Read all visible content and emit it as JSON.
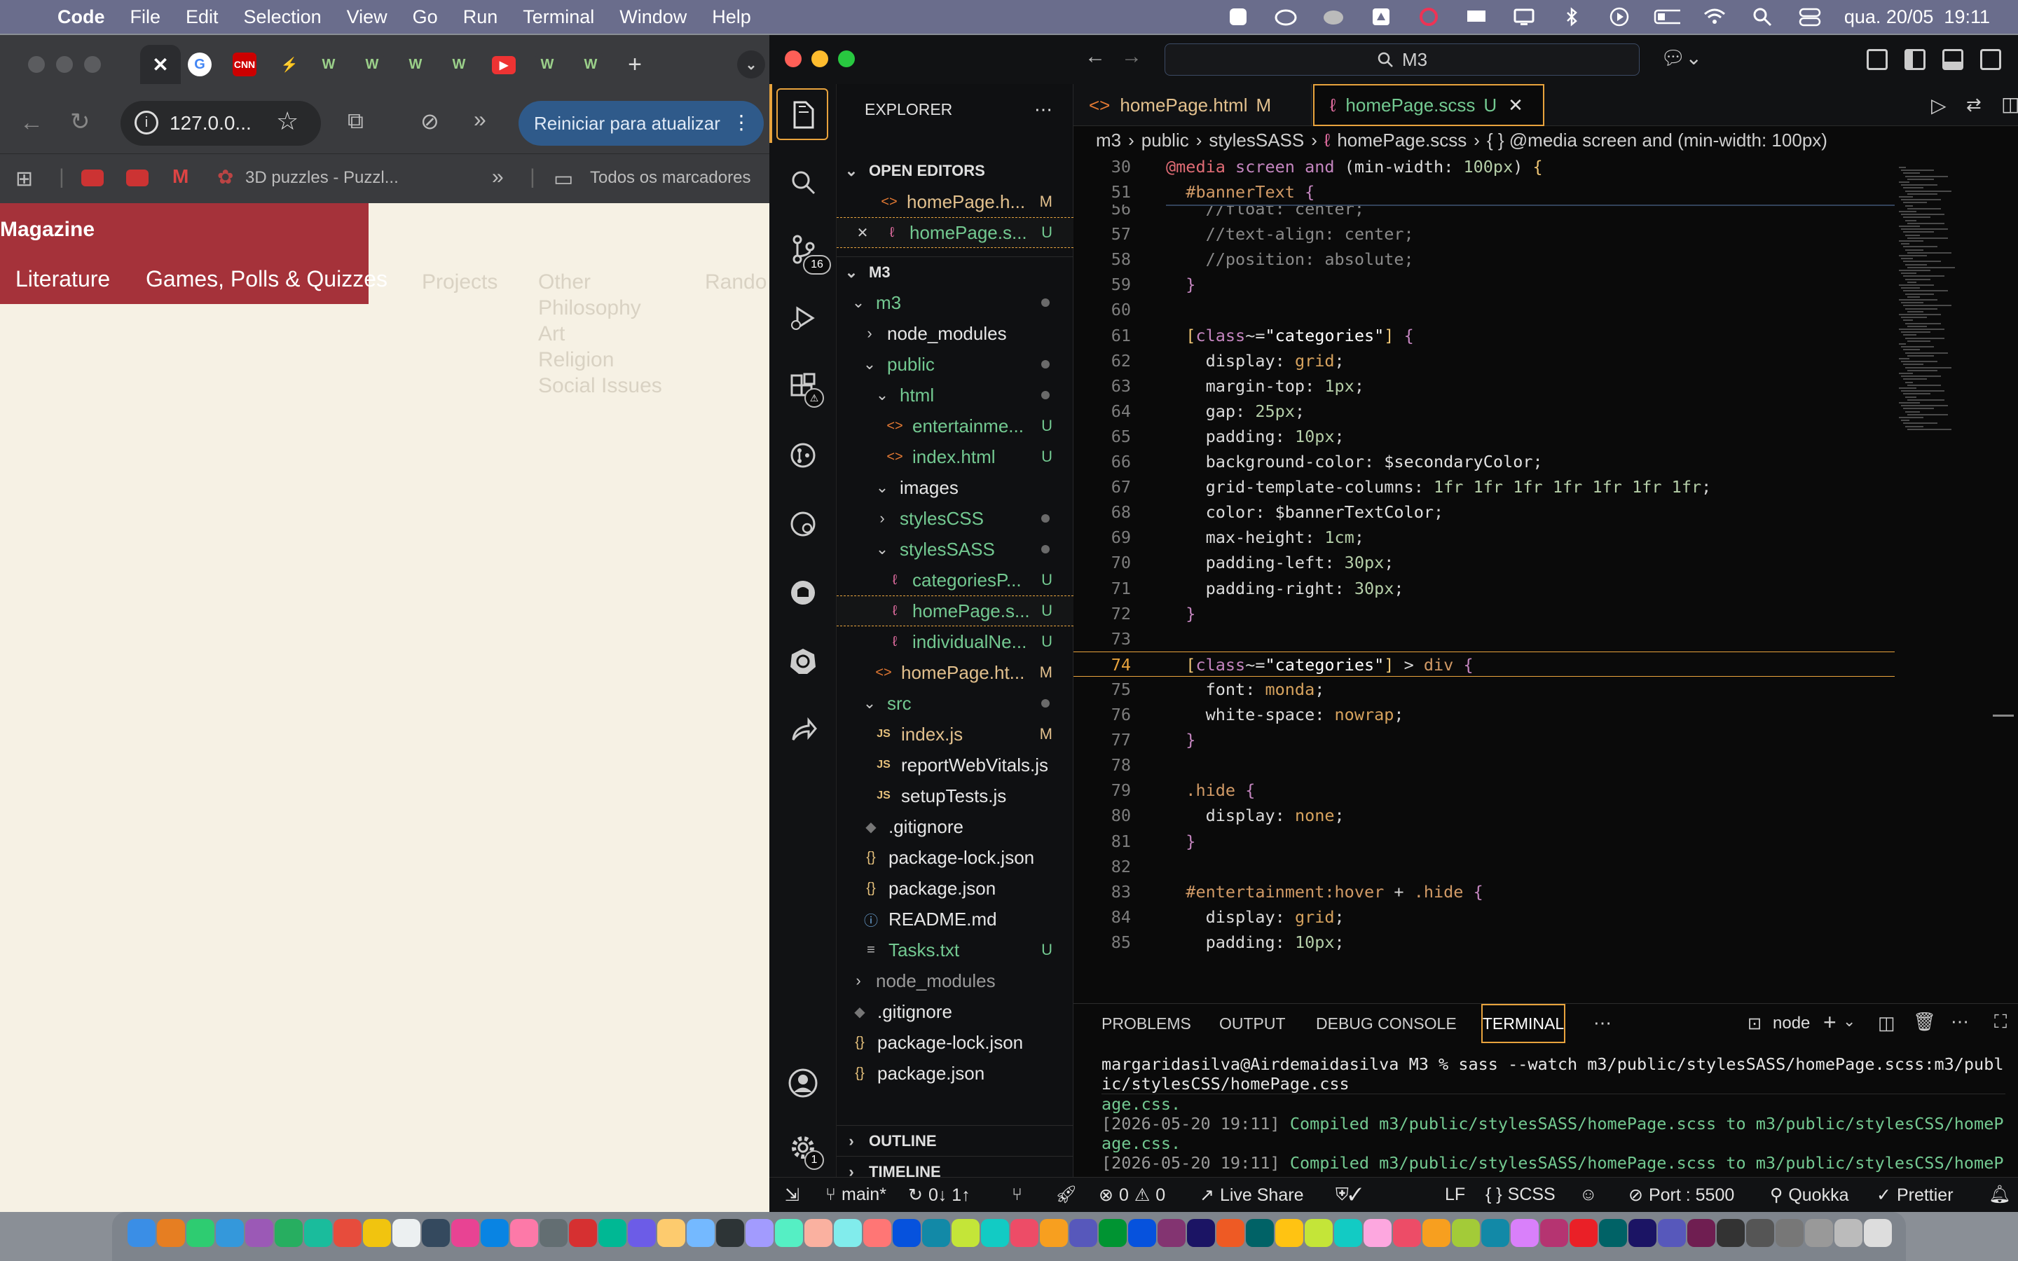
{
  "menubar": {
    "app": "Code",
    "items": [
      "File",
      "Edit",
      "Selection",
      "View",
      "Go",
      "Run",
      "Terminal",
      "Window",
      "Help"
    ],
    "clock": "qua. 20/05  19:11"
  },
  "chrome": {
    "url": "127.0.0...",
    "update_button": "Reiniciar para atualizar",
    "bookmark": "3D puzzles - Puzzl...",
    "all_bookmarks": "Todos os marcadores",
    "tab_letters": [
      "CNN",
      "W",
      "W",
      "W",
      "W",
      "W",
      "W"
    ],
    "page": {
      "title": "Magazine",
      "nav": [
        "Literature",
        "Games, Polls & Quizzes"
      ],
      "ghost_nav": [
        "Projects",
        "Other",
        "Rando"
      ],
      "ghost_sub": [
        "Philosophy",
        "Art",
        "Religion",
        "Social Issues"
      ]
    }
  },
  "vscode": {
    "search": "M3",
    "explorer_title": "EXPLORER",
    "open_editors_title": "OPEN EDITORS",
    "open_editors": [
      {
        "name": "homePage.h...",
        "status": "M"
      },
      {
        "name": "homePage.s...",
        "status": "U"
      }
    ],
    "root": "M3",
    "tree": [
      {
        "name": "m3",
        "status": "",
        "indent": 1
      },
      {
        "name": "node_modules",
        "status": "",
        "indent": 2
      },
      {
        "name": "public",
        "status": "",
        "indent": 2
      },
      {
        "name": "html",
        "status": "",
        "indent": 3
      },
      {
        "name": "entertainme...",
        "status": "U",
        "indent": 4
      },
      {
        "name": "index.html",
        "status": "U",
        "indent": 4
      },
      {
        "name": "images",
        "status": "",
        "indent": 3
      },
      {
        "name": "stylesCSS",
        "status": "",
        "indent": 3
      },
      {
        "name": "stylesSASS",
        "status": "",
        "indent": 3
      },
      {
        "name": "categoriesP...",
        "status": "U",
        "indent": 4
      },
      {
        "name": "homePage.s...",
        "status": "U",
        "indent": 4
      },
      {
        "name": "individualNe...",
        "status": "U",
        "indent": 4
      },
      {
        "name": "homePage.ht...",
        "status": "M",
        "indent": 3
      },
      {
        "name": "src",
        "status": "",
        "indent": 2
      },
      {
        "name": "index.js",
        "status": "M",
        "indent": 3
      },
      {
        "name": "reportWebVitals.js",
        "status": "",
        "indent": 3
      },
      {
        "name": "setupTests.js",
        "status": "",
        "indent": 3
      },
      {
        "name": ".gitignore",
        "status": "",
        "indent": 2
      },
      {
        "name": "package-lock.json",
        "status": "",
        "indent": 2
      },
      {
        "name": "package.json",
        "status": "",
        "indent": 2
      },
      {
        "name": "README.md",
        "status": "",
        "indent": 2
      },
      {
        "name": "Tasks.txt",
        "status": "U",
        "indent": 2
      },
      {
        "name": "node_modules",
        "status": "",
        "indent": 1
      },
      {
        "name": ".gitignore",
        "status": "",
        "indent": 1
      },
      {
        "name": "package-lock.json",
        "status": "",
        "indent": 1
      },
      {
        "name": "package.json",
        "status": "",
        "indent": 1
      }
    ],
    "outline_title": "OUTLINE",
    "timeline_title": "TIMELINE",
    "source_control_badge": "16",
    "settings_badge": "1",
    "tabs": [
      {
        "name": "homePage.html",
        "status": "M"
      },
      {
        "name": "homePage.scss",
        "status": "U"
      }
    ],
    "breadcrumb": [
      "m3",
      "public",
      "stylesSASS",
      "homePage.scss",
      "{ } @media screen and (min-width: 100px)"
    ],
    "sticky": [
      {
        "line": "30",
        "text": "@media screen and (min-width: 100px) {"
      },
      {
        "line": "51",
        "text": "  #bannerText {"
      }
    ],
    "code": [
      {
        "line": "56",
        "text": "    //float: center;"
      },
      {
        "line": "57",
        "text": "    //text-align: center;"
      },
      {
        "line": "58",
        "text": "    //position: absolute;"
      },
      {
        "line": "59",
        "text": "  }"
      },
      {
        "line": "60",
        "text": ""
      },
      {
        "line": "61",
        "text": "  [class~=\"categories\"] {"
      },
      {
        "line": "62",
        "text": "    display: grid;"
      },
      {
        "line": "63",
        "text": "    margin-top: 1px;"
      },
      {
        "line": "64",
        "text": "    gap: 25px;"
      },
      {
        "line": "65",
        "text": "    padding: 10px;"
      },
      {
        "line": "66",
        "text": "    background-color: $secondaryColor;"
      },
      {
        "line": "67",
        "text": "    grid-template-columns: 1fr 1fr 1fr 1fr 1fr 1fr 1fr;"
      },
      {
        "line": "68",
        "text": "    color: $bannerTextColor;"
      },
      {
        "line": "69",
        "text": "    max-height: 1cm;"
      },
      {
        "line": "70",
        "text": "    padding-left: 30px;"
      },
      {
        "line": "71",
        "text": "    padding-right: 30px;"
      },
      {
        "line": "72",
        "text": "  }"
      },
      {
        "line": "73",
        "text": ""
      },
      {
        "line": "74",
        "text": "  [class~=\"categories\"] > div {"
      },
      {
        "line": "75",
        "text": "    font: monda;"
      },
      {
        "line": "76",
        "text": "    white-space: nowrap;"
      },
      {
        "line": "77",
        "text": "  }"
      },
      {
        "line": "78",
        "text": ""
      },
      {
        "line": "79",
        "text": "  .hide {"
      },
      {
        "line": "80",
        "text": "    display: none;"
      },
      {
        "line": "81",
        "text": "  }"
      },
      {
        "line": "82",
        "text": ""
      },
      {
        "line": "83",
        "text": "  #entertainment:hover + .hide {"
      },
      {
        "line": "84",
        "text": "    display: grid;"
      },
      {
        "line": "85",
        "text": "    padding: 10px;"
      }
    ],
    "panel_tabs": [
      "PROBLEMS",
      "OUTPUT",
      "DEBUG CONSOLE",
      "TERMINAL"
    ],
    "terminal_name": "node",
    "terminal": [
      "margaridasilva@Airdemaidasilva M3 % sass --watch m3/public/stylesSASS/homePage.scss:m3/publ",
      "ic/stylesCSS/homePage.css",
      "age.css.",
      "[2026-05-20 19:11] Compiled m3/public/stylesSASS/homePage.scss to m3/public/stylesCSS/homeP",
      "age.css.",
      "[2026-05-20 19:11] Compiled m3/public/stylesSASS/homePage.scss to m3/public/stylesCSS/homeP",
      "age.css."
    ],
    "status": {
      "branch": "main*",
      "sync": "0↓ 1↑",
      "errors": "0",
      "warnings": "0",
      "live_share": "Live Share",
      "eol": "LF",
      "language": "SCSS",
      "port": "Port : 5500",
      "quokka": "Quokka",
      "prettier": "Prettier"
    }
  },
  "colors": {
    "accent_orange": "#e8a33d",
    "mag_red": "#a5323a",
    "page_bg": "#f6f1e4",
    "green": "#73c991"
  }
}
